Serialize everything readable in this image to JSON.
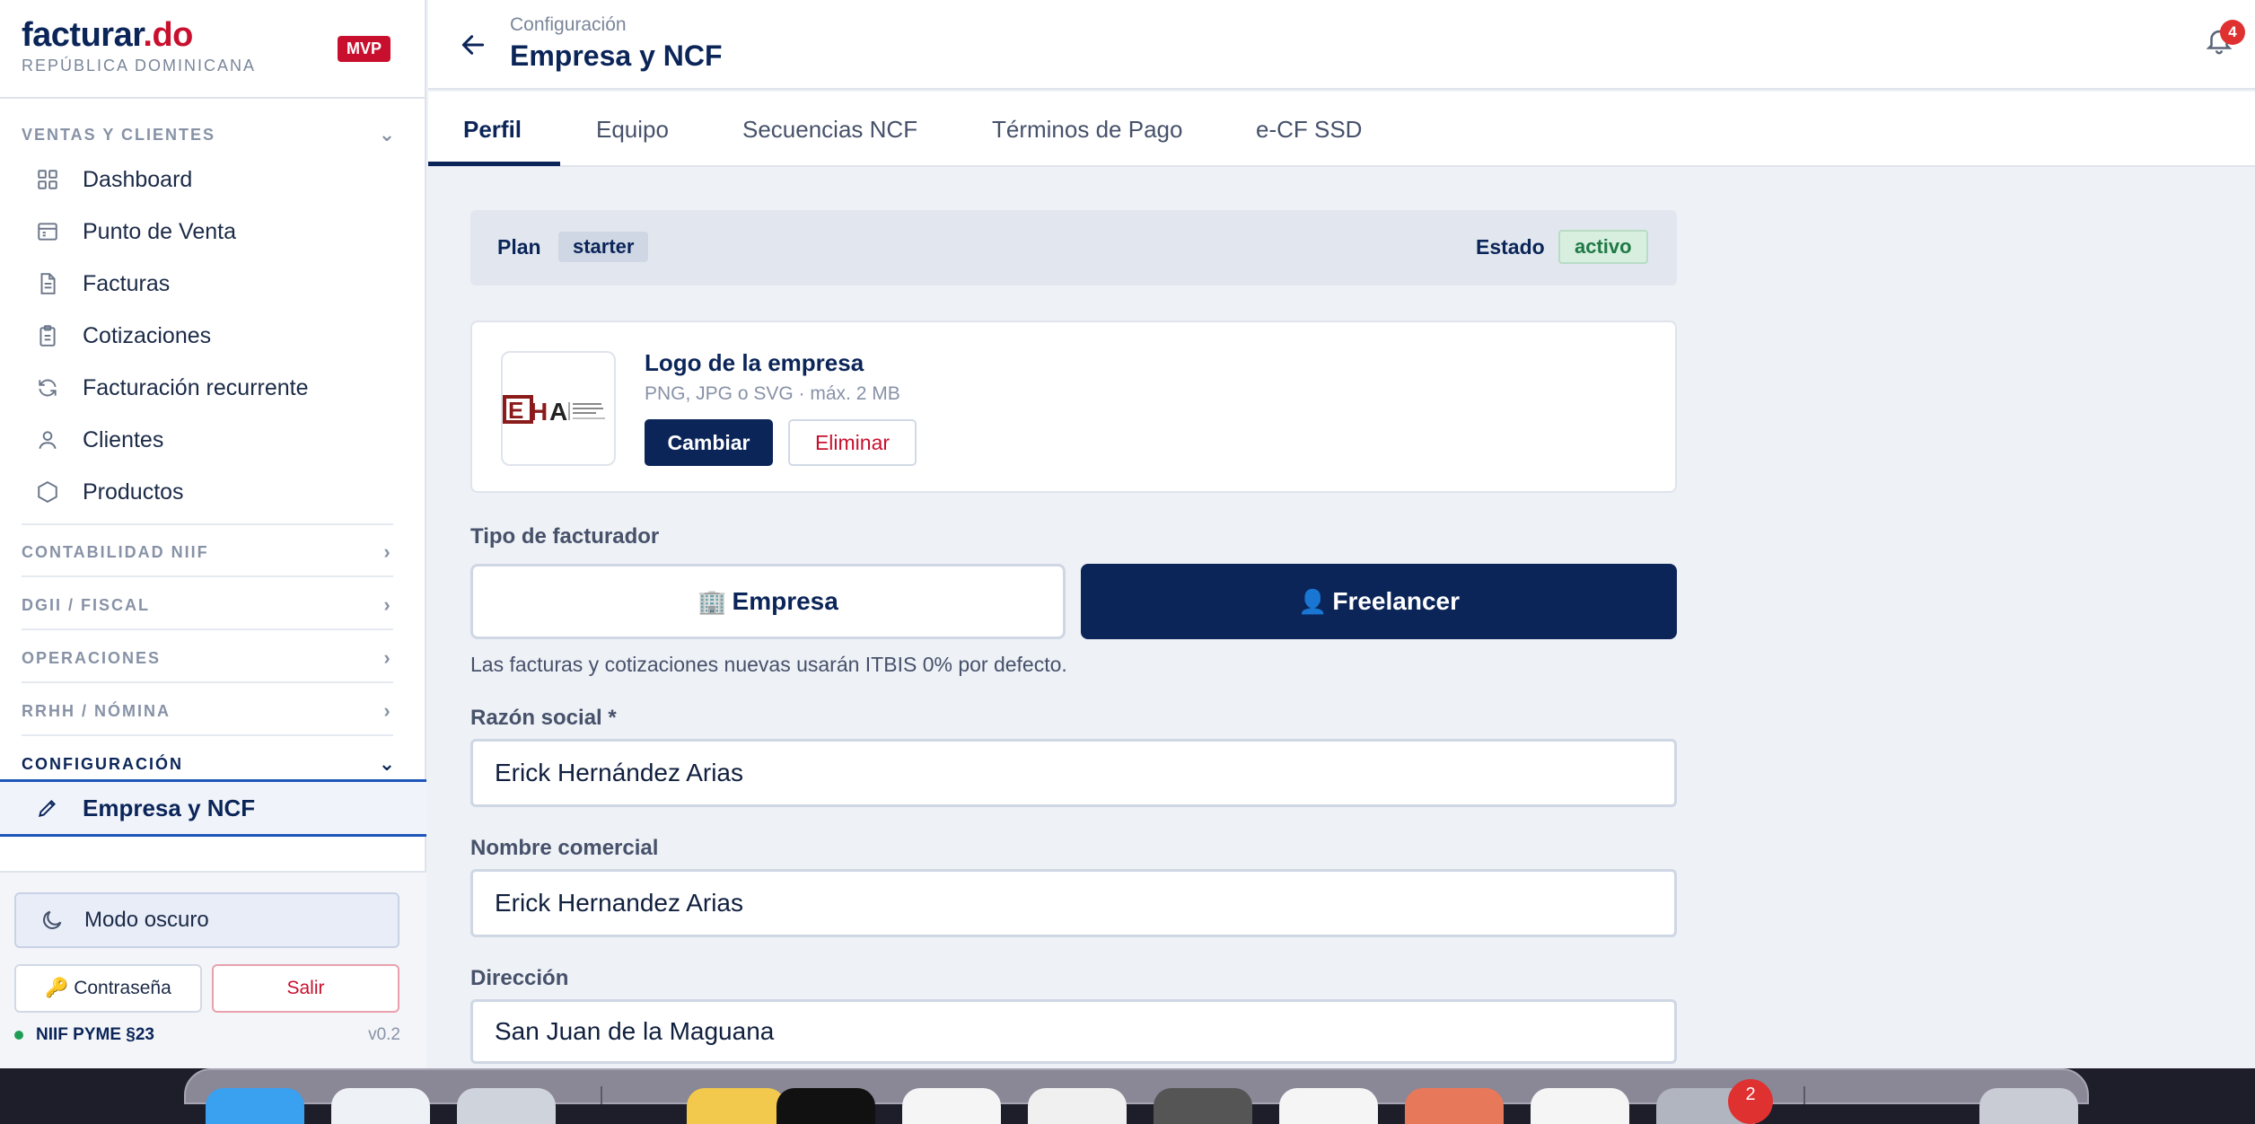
{
  "brand": {
    "name": "facturar",
    "tld": ".do",
    "country": "REPÚBLICA DOMINICANA",
    "badge": "MVP"
  },
  "sidebar": {
    "sections": [
      {
        "label": "VENTAS Y CLIENTES",
        "expanded": true
      },
      {
        "label": "CONTABILIDAD NIIF",
        "expanded": false
      },
      {
        "label": "DGII / FISCAL",
        "expanded": false
      },
      {
        "label": "OPERACIONES",
        "expanded": false
      },
      {
        "label": "RRHH / NÓMINA",
        "expanded": false
      },
      {
        "label": "CONFIGURACIÓN",
        "expanded": true
      }
    ],
    "items": [
      {
        "label": "Dashboard",
        "icon": "grid-icon"
      },
      {
        "label": "Punto de Venta",
        "icon": "register-icon"
      },
      {
        "label": "Facturas",
        "icon": "document-icon"
      },
      {
        "label": "Cotizaciones",
        "icon": "clipboard-icon"
      },
      {
        "label": "Facturación recurrente",
        "icon": "refresh-icon"
      },
      {
        "label": "Clientes",
        "icon": "user-icon"
      },
      {
        "label": "Productos",
        "icon": "hexagon-icon"
      }
    ],
    "active_item": {
      "label": "Empresa y NCF",
      "icon": "pencil-icon"
    },
    "footer": {
      "dark_mode": "Modo oscuro",
      "password": "🔑 Contraseña",
      "logout": "Salir",
      "status": "NIIF PYME §23",
      "version": "v0.2"
    }
  },
  "header": {
    "breadcrumb": "Configuración",
    "title": "Empresa y NCF",
    "notifications": "4"
  },
  "tabs": [
    {
      "label": "Perfil",
      "active": true
    },
    {
      "label": "Equipo",
      "active": false
    },
    {
      "label": "Secuencias NCF",
      "active": false
    },
    {
      "label": "Términos de Pago",
      "active": false
    },
    {
      "label": "e-CF SSD",
      "active": false
    }
  ],
  "plan": {
    "label": "Plan",
    "value": "starter",
    "status_label": "Estado",
    "status_value": "activo"
  },
  "logo": {
    "title": "Logo de la empresa",
    "hint": "PNG, JPG o SVG · máx. 2 MB",
    "change": "Cambiar",
    "delete": "Eliminar",
    "mark": "EHA"
  },
  "billing_type": {
    "label": "Tipo de facturador",
    "options": [
      {
        "label": "Empresa",
        "emoji": "🏢",
        "selected": false
      },
      {
        "label": "Freelancer",
        "emoji": "👤",
        "selected": true
      }
    ],
    "hint": "Las facturas y cotizaciones nuevas usarán ITBIS 0% por defecto."
  },
  "form": {
    "razon_social": {
      "label": "Razón social *",
      "value": "Erick Hernández Arias"
    },
    "nombre_comercial": {
      "label": "Nombre comercial",
      "value": "Erick Hernandez Arias"
    },
    "direccion": {
      "label": "Dirección",
      "value": "San Juan de la Maguana"
    }
  },
  "dock": {
    "badge": "2"
  },
  "colors": {
    "primary": "#0b2559",
    "accent": "#c8102e",
    "active_border": "#1e56b8",
    "success": "#1f7a45"
  }
}
